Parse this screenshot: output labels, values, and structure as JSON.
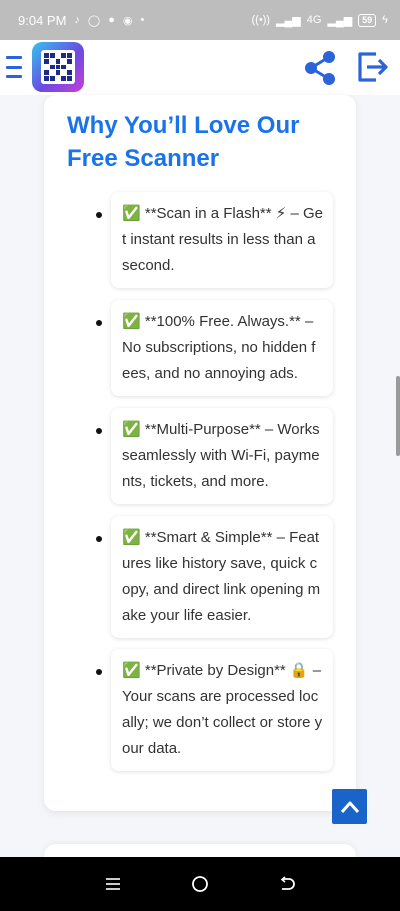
{
  "status_bar": {
    "time": "9:04 PM",
    "left_icons": [
      "tiktok-icon",
      "whatsapp-icon",
      "chat-icon",
      "chrome-icon",
      "dot-icon"
    ],
    "right_icons": [
      "hotspot-icon",
      "signal-icon",
      "network-4g-icon",
      "signal-icon"
    ],
    "network_label": "4G",
    "battery_level": "59"
  },
  "header": {
    "logo_alt_icon": "qr-code-logo-icon",
    "accent_color": "#2b63d9"
  },
  "section": {
    "title": "Why You’ll Love Our Free Scanner",
    "title_color": "#1a73e8",
    "features": [
      {
        "emoji": "✅",
        "text": "**Scan in a Flash** ⚡ – Get instant results in less than a second."
      },
      {
        "emoji": "✅",
        "text": "**100% Free. Always.** – No subscriptions, no hidden fees, and no annoying ads."
      },
      {
        "emoji": "✅",
        "text": "**Multi-Purpose** – Works seamlessly with Wi-Fi, payments, tickets, and more."
      },
      {
        "emoji": "✅",
        "text": "**Smart & Simple** – Features like history save, quick copy, and direct link opening make your life easier."
      },
      {
        "emoji": "✅",
        "text": "**Private by Design** 🔒 – Your scans are processed locally; we don’t collect or store your data."
      }
    ]
  },
  "back_to_top": {
    "icon": "chevron-up-icon",
    "color": "#1a63c9"
  },
  "nav_bar": {
    "icons": [
      "recent-apps-icon",
      "home-icon",
      "back-icon"
    ]
  }
}
